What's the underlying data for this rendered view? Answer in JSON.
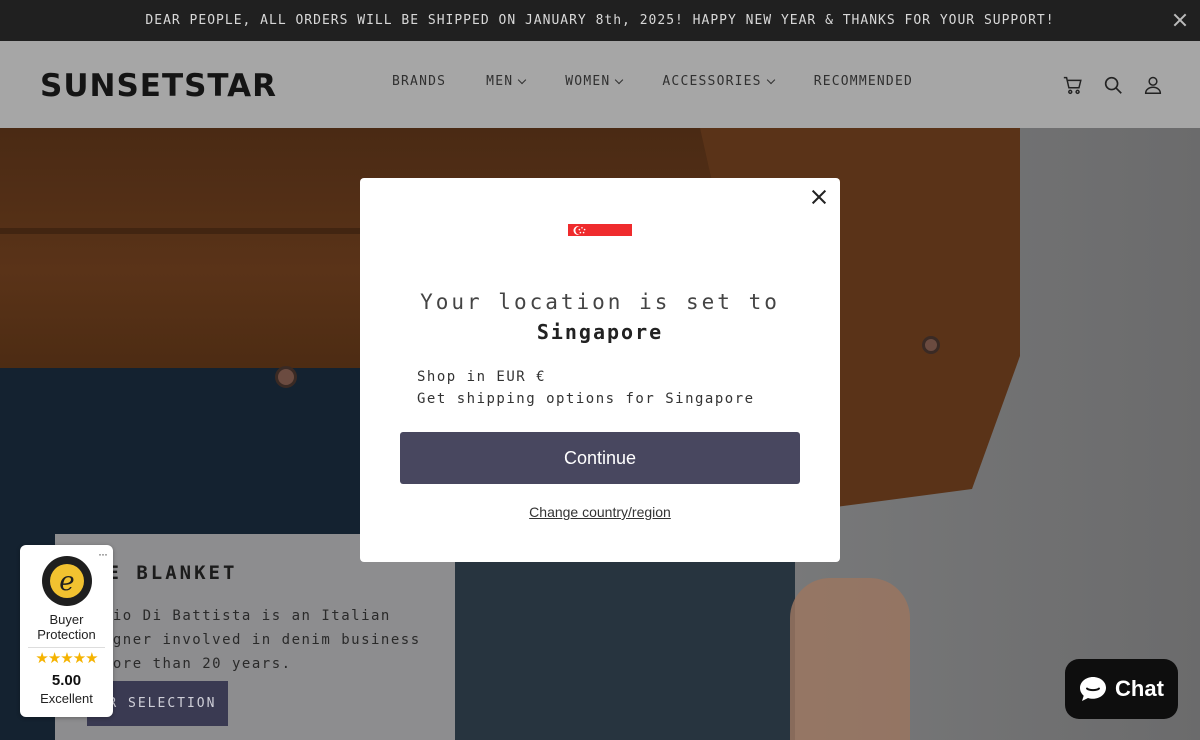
{
  "announcement": {
    "text": "DEAR PEOPLE, ALL ORDERS WILL BE SHIPPED ON JANUARY 8th, 2025! HAPPY NEW YEAR & THANKS FOR YOUR SUPPORT!"
  },
  "header": {
    "logo": "SUNSETSTAR",
    "nav": [
      {
        "label": "BRANDS",
        "dropdown": false
      },
      {
        "label": "MEN",
        "dropdown": true
      },
      {
        "label": "WOMEN",
        "dropdown": true
      },
      {
        "label": "ACCESSORIES",
        "dropdown": true
      },
      {
        "label": "RECOMMENDED",
        "dropdown": false
      }
    ],
    "icons": [
      "cart-icon",
      "search-icon",
      "account-icon"
    ]
  },
  "hero": {
    "title": "UE BLANKET",
    "text_lines": [
      "onio Di Battista is an Italian",
      "signer involved in denim business",
      " more than 20 years."
    ],
    "button": "UR SELECTION"
  },
  "modal": {
    "flag": "singapore-flag",
    "title": "Your location is set to",
    "country": "Singapore",
    "line1": "Shop in EUR €",
    "line2": "Get shipping options for Singapore",
    "continue": "Continue",
    "change_link": "Change country/region"
  },
  "trusted": {
    "label": "Buyer Protection",
    "stars": "★★★★★",
    "score": "5.00",
    "grade": "Excellent",
    "more": "···"
  },
  "chat": {
    "label": "Chat"
  },
  "colors": {
    "announcement_bg": "#202020",
    "header_bg": "#a6a6a6",
    "button_primary": "#48475f",
    "singapore_red": "#ef2b2d",
    "star": "#f5b301",
    "chat_bg": "#0e0e0e"
  }
}
